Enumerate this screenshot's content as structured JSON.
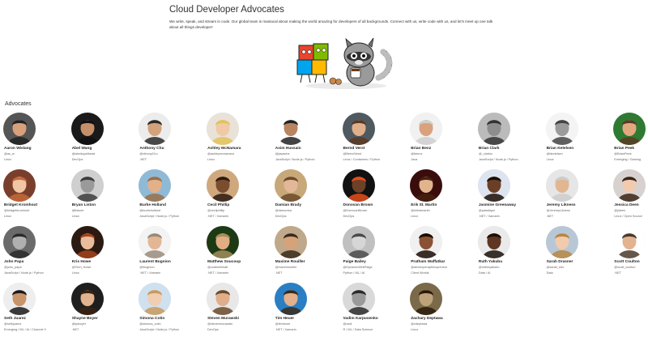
{
  "header": {
    "title": "Cloud Developer Advocates",
    "description": "We write, speak, and stream in code. Our global team is maniacal about making the world amazing for developers of all backgrounds. Connect with us, write code with us, and let's meet up one talk about all things developer!"
  },
  "section": {
    "title": "Advocates"
  },
  "colors": {
    "text": "#222222",
    "muted": "#666666",
    "avatar_bg": "#e5e5e5"
  },
  "advocates": [
    {
      "name": "Aaron Wislang",
      "handle": "@as_w",
      "topics": "Linux",
      "palette": [
        "#555555",
        "#d9a07c",
        "#222222"
      ]
    },
    {
      "name": "Abel Wang",
      "handle": "@abelsquidhead",
      "topics": "DevOps",
      "palette": [
        "#1a1a1a",
        "#c58f6a",
        "#111111"
      ]
    },
    {
      "name": "Anthony Chu",
      "handle": "@nthonyChu",
      "topics": ".NET",
      "palette": [
        "#ececec",
        "#d3a27a",
        "#2a2a2a"
      ]
    },
    {
      "name": "Ashley McNamara",
      "handle": "@ashleymcnamara",
      "topics": "Linux",
      "palette": [
        "#e9e2d8",
        "#f1c9a6",
        "#e3c25a"
      ]
    },
    {
      "name": "Asim Hussain",
      "handle": "@jawache",
      "topics": "JavaScript / Node.js / Python",
      "palette": [
        "#ffffff",
        "#b98460",
        "#222222"
      ]
    },
    {
      "name": "Bernd Verst",
      "handle": "@BerndVerst",
      "topics": "Linux / Containers / Python",
      "palette": [
        "#4f5a60",
        "#e0b08c",
        "#5a3a22"
      ]
    },
    {
      "name": "Brian Benz",
      "handle": "@bbenz",
      "topics": "Java",
      "palette": [
        "#f1f1f1",
        "#d9a27c",
        "#cfcfcf"
      ]
    },
    {
      "name": "Brian Clark",
      "handle": "@_clarkio",
      "topics": "JavaScript / Node.js / Python",
      "palette": [
        "#bbbbbb",
        "#8d8d8d",
        "#333333"
      ]
    },
    {
      "name": "Brian Ketelsen",
      "handle": "@bketelsen",
      "topics": "Linux",
      "palette": [
        "#f4f4f4",
        "#9b9b9b",
        "#444444"
      ]
    },
    {
      "name": "Brian Peek",
      "handle": "@BrianPeek",
      "topics": "Emerging / Gaming",
      "palette": [
        "#2f7a32",
        "#e2a97f",
        "#5a3b24"
      ]
    },
    {
      "name": "Bridget Kromhout",
      "handle": "@bridgetkromhout",
      "topics": "Linux",
      "palette": [
        "#7a3f2c",
        "#f0c6a4",
        "#c46a3a"
      ]
    },
    {
      "name": "Bryan Liston",
      "handle": "@listonb",
      "topics": "Linux",
      "palette": [
        "#cfcfcf",
        "#9a9a9a",
        "#3c3c3c"
      ]
    },
    {
      "name": "Burke Holland",
      "handle": "@burkeholland",
      "topics": "JavaScript / Node.js / Python",
      "palette": [
        "#8fbad6",
        "#e3b08a",
        "#9a6e4a"
      ]
    },
    {
      "name": "Cecil Phillip",
      "handle": "@cecilphillip",
      "topics": ".NET / Xamarin",
      "palette": [
        "#d0a87e",
        "#7b4d2f",
        "#2a1a10"
      ]
    },
    {
      "name": "Damian Brady",
      "handle": "@damovisa",
      "topics": "DevOps",
      "palette": [
        "#c8a878",
        "#e2b898",
        "#6a4a2a"
      ]
    },
    {
      "name": "Donovan Brown",
      "handle": "@DonovanBrown",
      "topics": "DevOps",
      "palette": [
        "#111111",
        "#6d4128",
        "#e74c1c"
      ]
    },
    {
      "name": "Erik St. Martin",
      "handle": "@erikstmartin",
      "topics": "Linux",
      "palette": [
        "#3a0d0d",
        "#e2b48e",
        "#442211"
      ]
    },
    {
      "name": "Jasmine Greenaway",
      "handle": "@paladique",
      "topics": ".NET / Xamarin",
      "palette": [
        "#dde4f0",
        "#6b3f26",
        "#1a0e07"
      ]
    },
    {
      "name": "Jeremy Likness",
      "handle": "@JeremyLikness",
      "topics": ".NET",
      "palette": [
        "#e6e6e6",
        "#e2b690",
        "#cccccc"
      ]
    },
    {
      "name": "Jessica Deen",
      "handle": "@jldeen",
      "topics": "Linux / Open Source",
      "palette": [
        "#d7d2cf",
        "#f0cbb0",
        "#3a2417"
      ]
    },
    {
      "name": "John Papa",
      "handle": "@john_papa",
      "topics": "JavaScript / Node.js / Python",
      "palette": [
        "#6a6a6a",
        "#b0b0b0",
        "#2a2a2a"
      ]
    },
    {
      "name": "Kris Howe",
      "handle": "@Tech_Howe",
      "topics": "Linux",
      "palette": [
        "#2b1a12",
        "#e9bd9c",
        "#a4441f"
      ]
    },
    {
      "name": "Laurent Bugnion",
      "handle": "@lbugnion",
      "topics": ".NET / Xamarin",
      "palette": [
        "#f3f3f3",
        "#e3b795",
        "#9a8a7a"
      ]
    },
    {
      "name": "Matthew Soucoup",
      "handle": "@codemillmatt",
      "topics": ".NET / Xamarin",
      "palette": [
        "#1c3a14",
        "#e2ad84",
        "#a58e5a"
      ]
    },
    {
      "name": "Maxime Rouiller",
      "handle": "@maximrouiller",
      "topics": ".NET",
      "palette": [
        "#bfa98a",
        "#d6a27a",
        "#3a2a1a"
      ]
    },
    {
      "name": "Paige Bailey",
      "handle": "@DynamicWebPaige",
      "topics": "Python / ML / AI",
      "palette": [
        "#c0c0c0",
        "#d6d6d6",
        "#4a4a4a"
      ]
    },
    {
      "name": "Pratham Waffatkar",
      "handle": "@developerapthecpreneur",
      "topics": "Client Worlds",
      "palette": [
        "#f0f0f0",
        "#8a5234",
        "#1a0d05"
      ]
    },
    {
      "name": "Ruth Yakubu",
      "handle": "@ruthieyakubu",
      "topics": "Data / AI",
      "palette": [
        "#eaeaea",
        "#5e3623",
        "#1a0f08"
      ]
    },
    {
      "name": "Sarah Drasner",
      "handle": "@sarah_edo",
      "topics": "Data",
      "palette": [
        "#b8c7d6",
        "#f0cbb0",
        "#b8863f"
      ]
    },
    {
      "name": "Scott Coulton",
      "handle": "@scott_coulton",
      "topics": ".NET",
      "palette": [
        "#ffffff",
        "#e3b28f",
        "#4a3a2a"
      ]
    },
    {
      "name": "Seth Juarez",
      "handle": "@sethjuarez",
      "topics": "Emerging / ML / AI / Channel 9",
      "palette": [
        "#eeeeee",
        "#c8946a",
        "#1a1a1a"
      ]
    },
    {
      "name": "Shayne Boyer",
      "handle": "@spboyer",
      "topics": ".NET",
      "palette": [
        "#1e1e1e",
        "#e2b28e",
        "#3a2212"
      ]
    },
    {
      "name": "Simona Cotin",
      "handle": "@simona_cotin",
      "topics": "JavaScript / Node.js / Python",
      "palette": [
        "#cfe0ef",
        "#f1cdb1",
        "#c89a5a"
      ]
    },
    {
      "name": "Steven Murawski",
      "handle": "@stevenmurawski",
      "topics": "DevOps",
      "palette": [
        "#e8e8e8",
        "#e0ae8a",
        "#6a4a2a"
      ]
    },
    {
      "name": "Tim Heuer",
      "handle": "@timheuer",
      "topics": ".NET / Xamarin",
      "palette": [
        "#2a7fc4",
        "#e2b08c",
        "#3a2a1a"
      ]
    },
    {
      "name": "Vadim Karpusenko",
      "handle": "@vadi",
      "topics": "R / ML / Data Science",
      "palette": [
        "#d9d9d9",
        "#9a9a9a",
        "#2a2a2a"
      ]
    },
    {
      "name": "Zachary Deptawa",
      "handle": "@zdeptawa",
      "topics": "Linux",
      "palette": [
        "#7a6a4a",
        "#bda27a",
        "#2a1a0a"
      ]
    }
  ]
}
